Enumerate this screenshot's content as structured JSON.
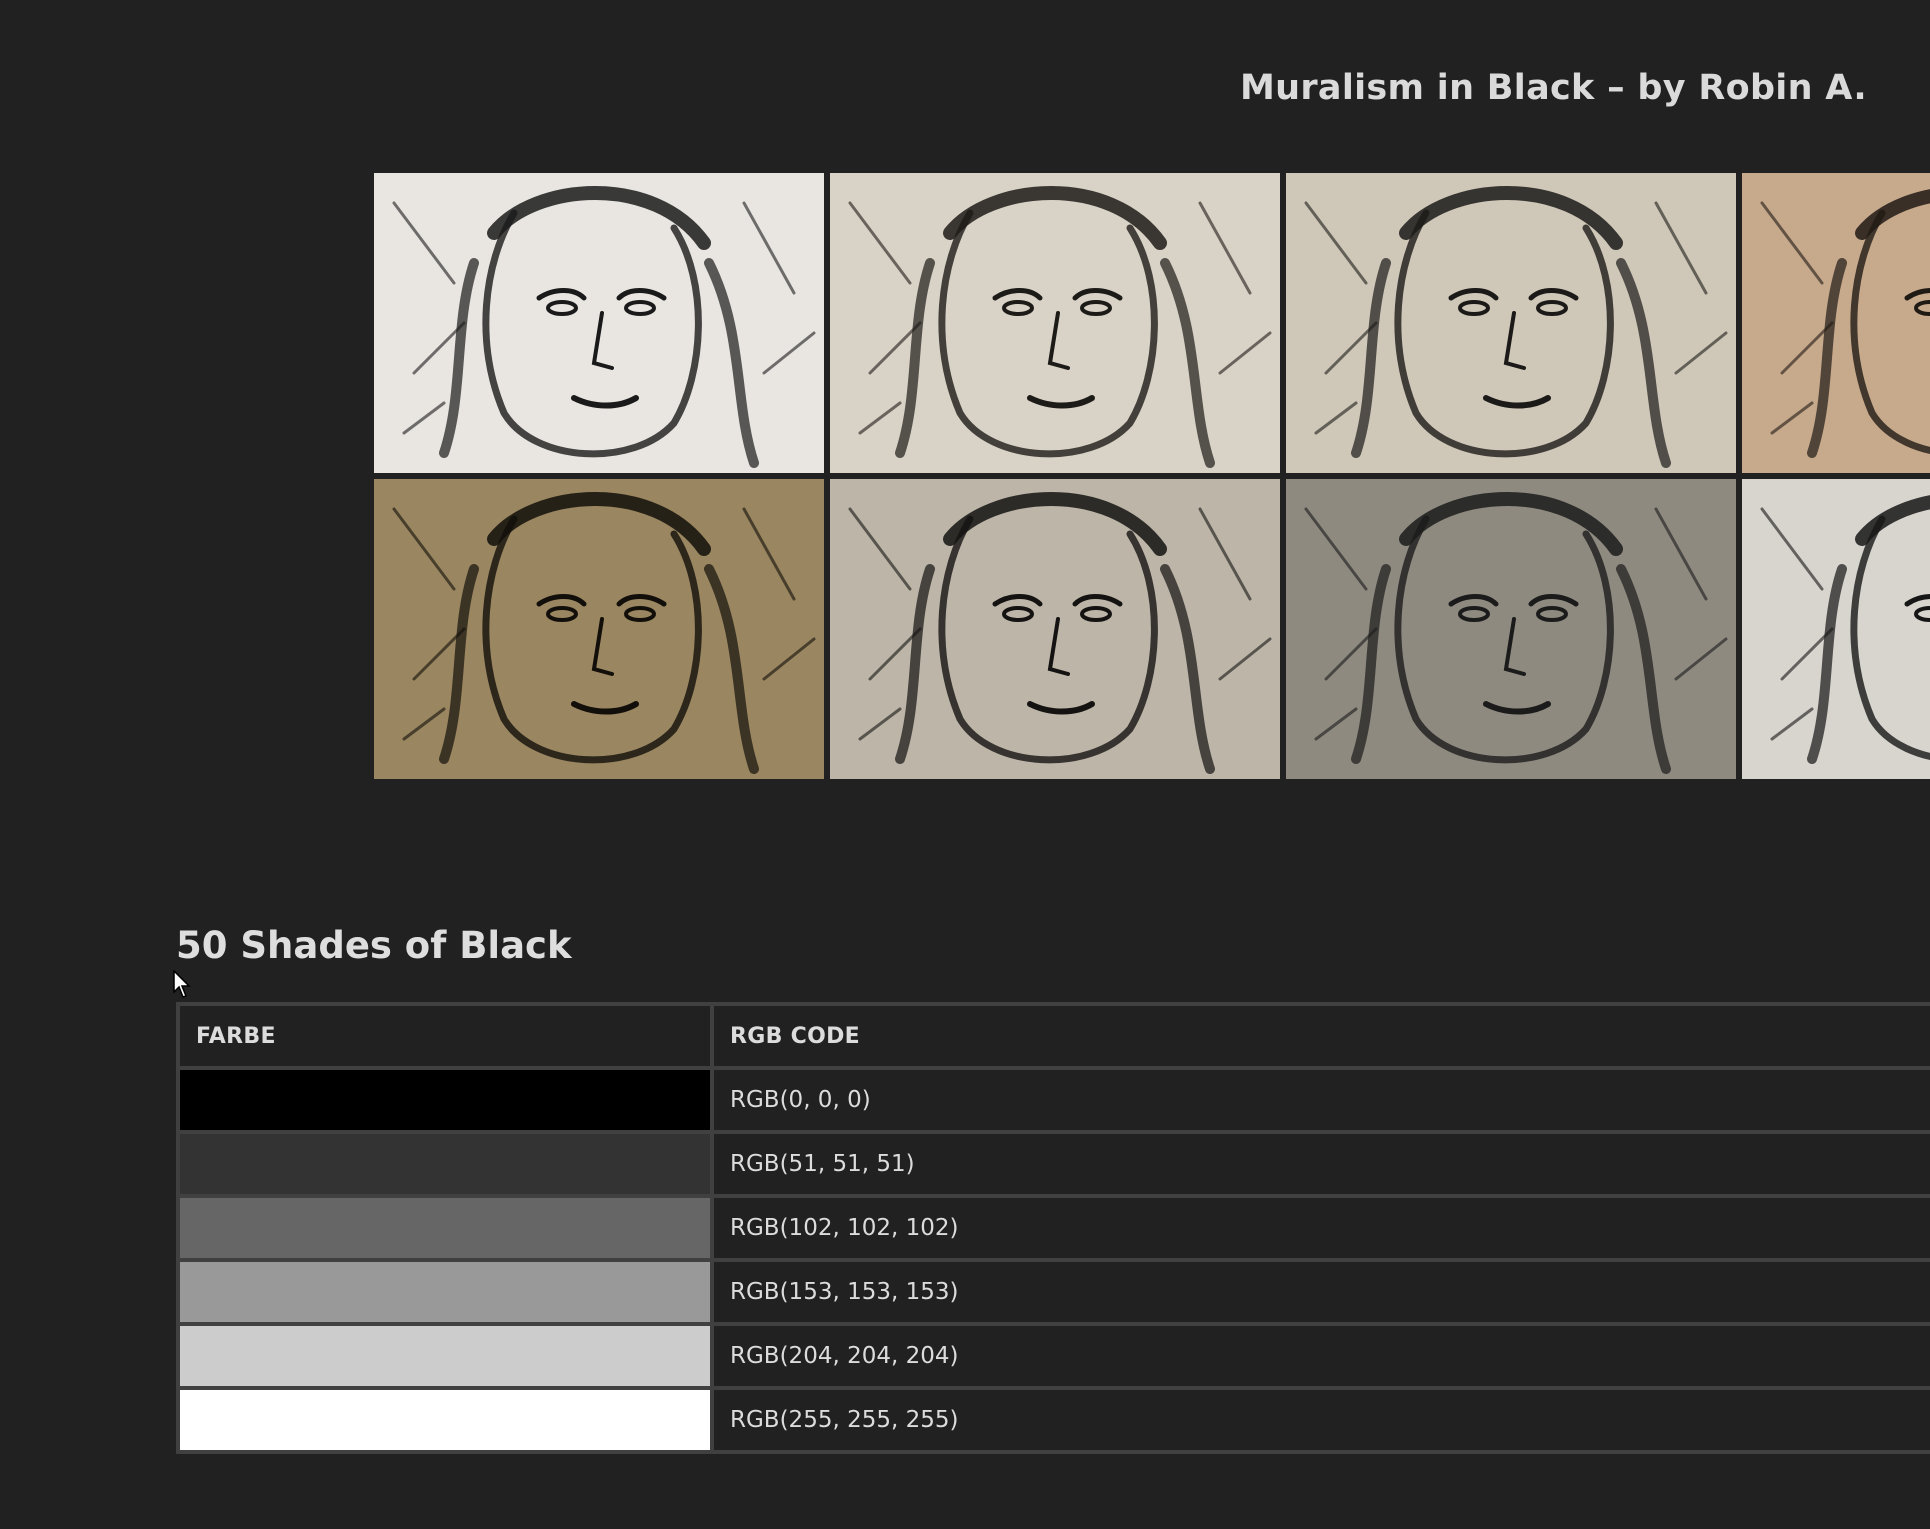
{
  "gallery": {
    "title": "Muralism in Black – by Robin A.",
    "images": [
      {
        "name": "mural-woman-scratched-wall-artist",
        "tone": "#e9e6e2",
        "ink": "#1a1a1a"
      },
      {
        "name": "mural-woman-brick-wall",
        "tone": "#d9d2c6",
        "ink": "#1d1b18"
      },
      {
        "name": "mural-woman-house-facade",
        "tone": "#cfc7b8",
        "ink": "#1b1a18"
      },
      {
        "name": "mural-woman-wooden-wall-partial",
        "tone": "#c7a98c",
        "ink": "#201a14"
      },
      {
        "name": "mural-woman-dark-interior",
        "tone": "#9a8660",
        "ink": "#120f0a"
      },
      {
        "name": "mural-woman-wooden-panels",
        "tone": "#bdb6a8",
        "ink": "#141312"
      },
      {
        "name": "mural-woman-building-street",
        "tone": "#8f8a80",
        "ink": "#1b1b1b"
      },
      {
        "name": "mural-woman-partial-right",
        "tone": "#d8d4ce",
        "ink": "#161616"
      }
    ]
  },
  "shades": {
    "heading": "50 Shades of Black",
    "columns": [
      "FARBE",
      "RGB CODE"
    ],
    "rows": [
      {
        "color": "#000000",
        "code": "RGB(0, 0, 0)"
      },
      {
        "color": "#333333",
        "code": "RGB(51, 51, 51)"
      },
      {
        "color": "#666666",
        "code": "RGB(102, 102, 102)"
      },
      {
        "color": "#999999",
        "code": "RGB(153, 153, 153)"
      },
      {
        "color": "#cccccc",
        "code": "RGB(204, 204, 204)"
      },
      {
        "color": "#ffffff",
        "code": "RGB(255, 255, 255)"
      }
    ]
  }
}
